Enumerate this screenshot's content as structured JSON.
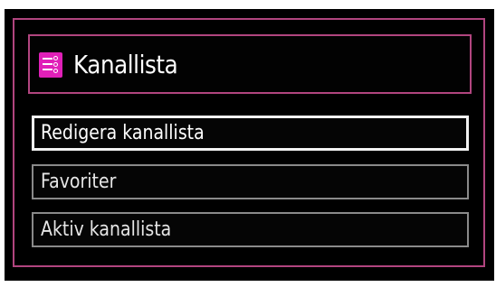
{
  "header": {
    "title": "Kanallista",
    "icon": "channel-list-icon",
    "accent_color": "#e020b8",
    "frame_color": "#b1457f"
  },
  "menu": {
    "selected_index": 0,
    "items": [
      {
        "label": "Redigera kanallista"
      },
      {
        "label": "Favoriter"
      },
      {
        "label": "Aktiv kanallista"
      }
    ]
  }
}
